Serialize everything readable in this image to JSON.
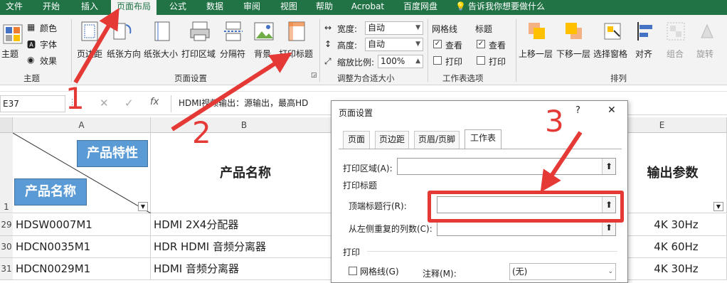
{
  "ribbon_tabs": [
    "文件",
    "开始",
    "插入",
    "页面布局",
    "公式",
    "数据",
    "审阅",
    "视图",
    "帮助",
    "Acrobat",
    "百度网盘",
    "告诉我你想要做什么"
  ],
  "active_tab": "页面布局",
  "ribbon": {
    "themes": {
      "main": "主题",
      "colors": "颜色",
      "fonts": "字体",
      "effects": "效果",
      "group": "主题"
    },
    "page_setup": {
      "margins": "页边距",
      "orientation": "纸张方向",
      "size": "纸张大小",
      "print_area": "打印区域",
      "breaks": "分隔符",
      "background": "背景",
      "print_titles": "打印标题",
      "group": "页面设置"
    },
    "scale": {
      "width_label": "宽度:",
      "width_value": "自动",
      "height_label": "高度:",
      "height_value": "自动",
      "scale_label": "缩放比例:",
      "scale_value": "100%",
      "group": "调整为合适大小"
    },
    "sheet_options": {
      "gridlines": "网格线",
      "headings": "标题",
      "view": "查看",
      "print": "打印",
      "group": "工作表选项"
    },
    "arrange": {
      "forward": "上移一层",
      "backward": "下移一层",
      "selection_pane": "选择窗格",
      "align": "对齐",
      "group_btn": "组合",
      "rotate": "旋转",
      "group": "排列"
    }
  },
  "formula_bar": {
    "name_box": "E37",
    "fx": "fx",
    "content": "HDMI视频输出：源输出，最高HD"
  },
  "sheet": {
    "columns": [
      "A",
      "B",
      "E"
    ],
    "header_row": "1",
    "header_badge_top": "产品特性",
    "header_badge_bottom": "产品名称",
    "header_b": "产品名称",
    "header_e": "输出参数",
    "rows": [
      {
        "row": "29",
        "a": "HDSW0007M1",
        "b": "HDMI 2X4分配器",
        "e": "4K 30Hz"
      },
      {
        "row": "30",
        "a": "HDCN0035M1",
        "b": "HDR HDMI 音频分离器",
        "e": "4K 60Hz"
      },
      {
        "row": "31",
        "a": "HDCN0029M1",
        "b": "HDMI 音频分离器",
        "e": "4K 30Hz"
      }
    ]
  },
  "dialog": {
    "title": "页面设置",
    "help": "?",
    "close": "✕",
    "tabs": [
      "页面",
      "页边距",
      "页眉/页脚",
      "工作表"
    ],
    "active_tab": "工作表",
    "print_area_label": "打印区域(A):",
    "print_titles_label": "打印标题",
    "top_rows_label": "顶端标题行(R):",
    "left_cols_label": "从左侧重复的列数(C):",
    "print_section": "打印",
    "gridlines": "网格线(G)",
    "comments_label": "注释(M):",
    "comments_value": "(无)"
  },
  "annotations": [
    "1",
    "2",
    "3"
  ],
  "colors": {
    "excel_green": "#217346",
    "badge_blue": "#5b9bd5",
    "highlight_red": "#e53935"
  }
}
